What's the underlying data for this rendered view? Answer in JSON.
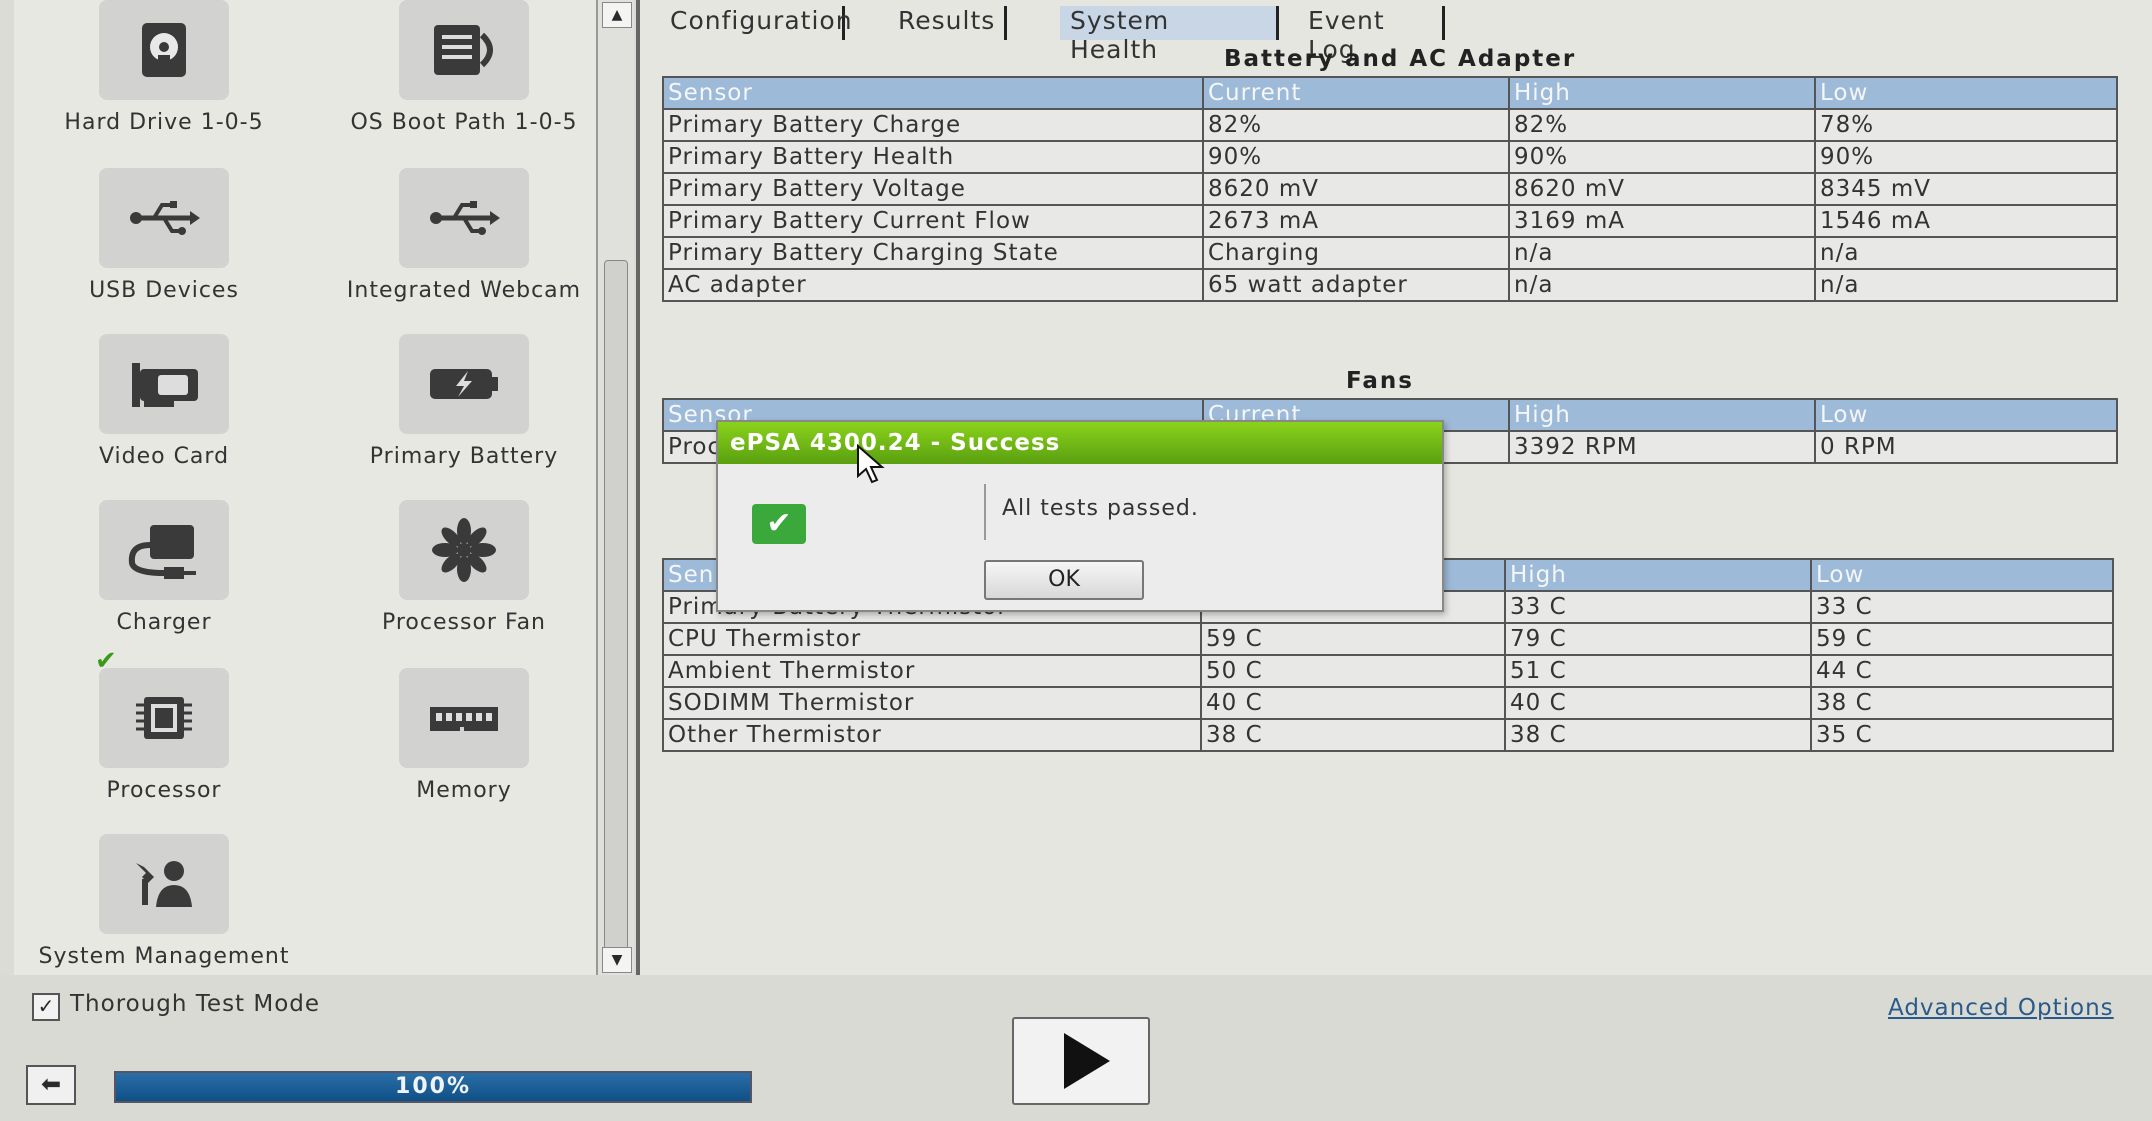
{
  "devices": [
    {
      "label": "Hard Drive 1-0-5",
      "icon": "hard-drive-icon"
    },
    {
      "label": "OS Boot Path 1-0-5",
      "icon": "os-boot-path-icon"
    },
    {
      "label": "USB Devices",
      "icon": "usb-icon"
    },
    {
      "label": "Integrated Webcam",
      "icon": "webcam-usb-icon"
    },
    {
      "label": "Video Card",
      "icon": "video-card-icon"
    },
    {
      "label": "Primary Battery",
      "icon": "battery-icon"
    },
    {
      "label": "Charger",
      "icon": "charger-icon"
    },
    {
      "label": "Processor Fan",
      "icon": "fan-icon"
    },
    {
      "label": "Processor",
      "icon": "processor-icon",
      "checked": true
    },
    {
      "label": "Memory",
      "icon": "memory-icon"
    },
    {
      "label": "System Management",
      "icon": "system-management-icon"
    }
  ],
  "tabs": [
    {
      "label": "Configuration"
    },
    {
      "label": "Results"
    },
    {
      "label": "System Health",
      "active": true
    },
    {
      "label": "Event Log"
    }
  ],
  "battery_section": {
    "title": "Battery and AC Adapter",
    "headers": [
      "Sensor",
      "Current",
      "High",
      "Low"
    ],
    "rows": [
      [
        "Primary Battery Charge",
        "82%",
        "82%",
        "78%"
      ],
      [
        "Primary Battery Health",
        "90%",
        "90%",
        "90%"
      ],
      [
        "Primary Battery Voltage",
        "8620 mV",
        "8620 mV",
        "8345 mV"
      ],
      [
        "Primary Battery Current Flow",
        "2673 mA",
        "3169 mA",
        "1546 mA"
      ],
      [
        "Primary Battery Charging State",
        "Charging",
        "n/a",
        "n/a"
      ],
      [
        "AC adapter",
        "65 watt adapter",
        "n/a",
        "n/a"
      ]
    ]
  },
  "fans_section": {
    "title": "Fans",
    "headers": [
      "Sensor",
      "Current",
      "High",
      "Low"
    ],
    "rows": [
      [
        "Proc",
        "",
        "3392 RPM",
        "0 RPM"
      ]
    ]
  },
  "thermal_section": {
    "headers": [
      "Sen",
      "",
      "High",
      "Low"
    ],
    "rows": [
      [
        "Primary Battery Thermistor",
        "",
        "33 C",
        "33 C"
      ],
      [
        "CPU Thermistor",
        "59 C",
        "79 C",
        "59 C"
      ],
      [
        "Ambient Thermistor",
        "50 C",
        "51 C",
        "44 C"
      ],
      [
        "SODIMM Thermistor",
        "40 C",
        "40 C",
        "38 C"
      ],
      [
        "Other Thermistor",
        "38 C",
        "38 C",
        "35 C"
      ]
    ]
  },
  "dialog": {
    "title": "ePSA 4300.24 - Success",
    "message": "All tests passed.",
    "ok_label": "OK"
  },
  "bottom": {
    "thorough_label": "Thorough Test Mode",
    "thorough_checked": true,
    "progress_text": "100%",
    "progress_value": 1.0,
    "advanced_label": "Advanced Options"
  },
  "colors": {
    "header_blue": "#9dbad8",
    "success_green": "#6ab814",
    "progress_blue": "#1a5d94"
  }
}
